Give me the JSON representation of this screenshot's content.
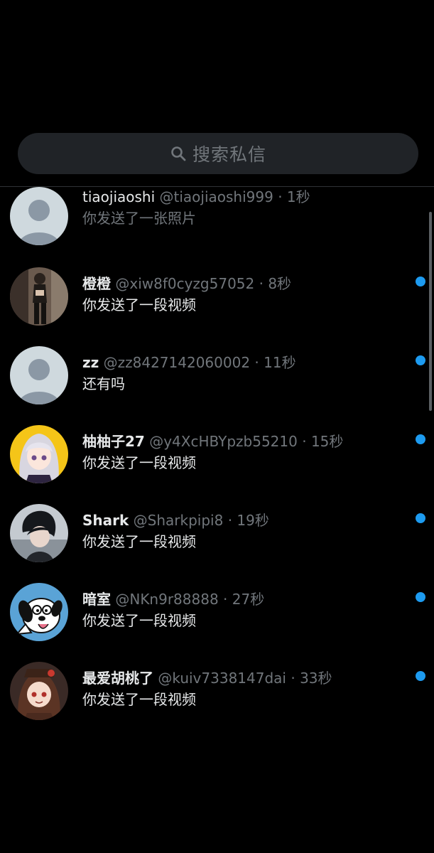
{
  "search": {
    "placeholder": "搜索私信"
  },
  "conversations": [
    {
      "name": "tiaojiaoshi",
      "handle": "@tiaojiaoshi999",
      "time": "1秒",
      "preview": "你发送了一张照片",
      "unread": false,
      "avatar": "default-avatar"
    },
    {
      "name": "橙橙",
      "handle": "@xiw8f0cyzg57052",
      "time": "8秒",
      "preview": "你发送了一段视频",
      "unread": true,
      "avatar": "photo-avatar"
    },
    {
      "name": "zz",
      "handle": "@zz8427142060002",
      "time": "11秒",
      "preview": "还有吗",
      "unread": true,
      "avatar": "default-avatar"
    },
    {
      "name": "柚柚子27",
      "handle": "@y4XcHBYpzb55210",
      "time": "15秒",
      "preview": "你发送了一段视频",
      "unread": true,
      "avatar": "anime-girl-avatar"
    },
    {
      "name": "Shark",
      "handle": "@Sharkpipi8",
      "time": "19秒",
      "preview": "你发送了一段视频",
      "unread": true,
      "avatar": "anime-boy-avatar"
    },
    {
      "name": "暗室",
      "handle": "@NKn9r88888",
      "time": "27秒",
      "preview": "你发送了一段视频",
      "unread": true,
      "avatar": "cartoon-dog-avatar"
    },
    {
      "name": "最爱胡桃了",
      "handle": "@kuiv7338147dai",
      "time": "33秒",
      "preview": "你发送了一段视频",
      "unread": true,
      "avatar": "anime-character-avatar"
    }
  ],
  "colors": {
    "background": "#000000",
    "unread_dot": "#1d9bf0",
    "secondary_text": "#71767b",
    "primary_text": "#e7e9ea",
    "search_bg": "#202327"
  }
}
